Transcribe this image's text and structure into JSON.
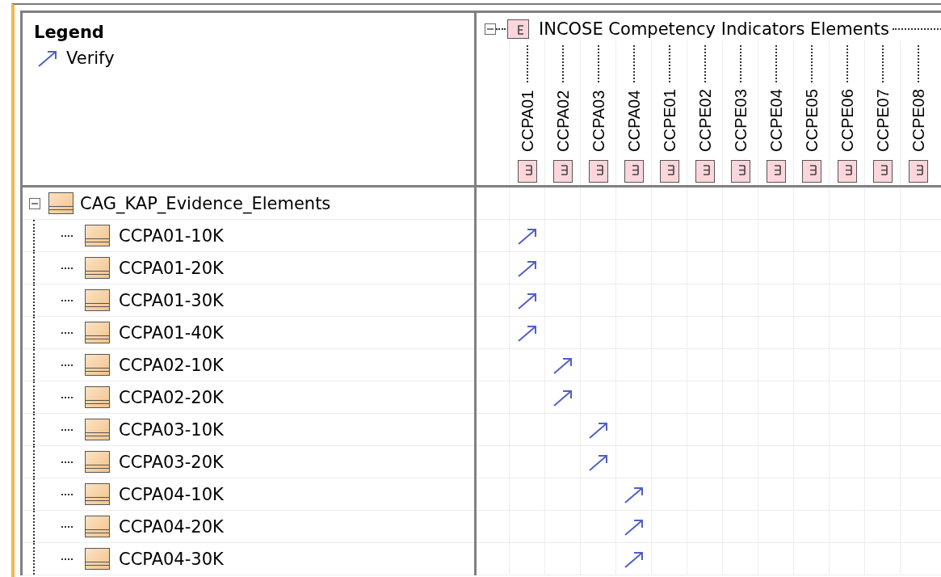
{
  "legend": {
    "title": "Legend",
    "items": [
      {
        "kind": "verify",
        "label": "Verify"
      }
    ]
  },
  "column_group": {
    "label": "INCOSE Competency Indicators Elements",
    "expanded": true,
    "columns": [
      "CCPA01",
      "CCPA02",
      "CCPA03",
      "CCPA04",
      "CCPE01",
      "CCPE02",
      "CCPE03",
      "CCPE04",
      "CCPE05",
      "CCPE06",
      "CCPE07",
      "CCPE08"
    ]
  },
  "row_group": {
    "label": "CAG_KAP_Evidence_Elements",
    "expanded": true,
    "cells": [
      false,
      false,
      false,
      false,
      false,
      false,
      false,
      false,
      false,
      false,
      false,
      false
    ],
    "children": [
      {
        "label": "CCPA01-10K",
        "cells": [
          true,
          false,
          false,
          false,
          false,
          false,
          false,
          false,
          false,
          false,
          false,
          false
        ]
      },
      {
        "label": "CCPA01-20K",
        "cells": [
          true,
          false,
          false,
          false,
          false,
          false,
          false,
          false,
          false,
          false,
          false,
          false
        ]
      },
      {
        "label": "CCPA01-30K",
        "cells": [
          true,
          false,
          false,
          false,
          false,
          false,
          false,
          false,
          false,
          false,
          false,
          false
        ]
      },
      {
        "label": "CCPA01-40K",
        "cells": [
          true,
          false,
          false,
          false,
          false,
          false,
          false,
          false,
          false,
          false,
          false,
          false
        ]
      },
      {
        "label": "CCPA02-10K",
        "cells": [
          false,
          true,
          false,
          false,
          false,
          false,
          false,
          false,
          false,
          false,
          false,
          false
        ]
      },
      {
        "label": "CCPA02-20K",
        "cells": [
          false,
          true,
          false,
          false,
          false,
          false,
          false,
          false,
          false,
          false,
          false,
          false
        ]
      },
      {
        "label": "CCPA03-10K",
        "cells": [
          false,
          false,
          true,
          false,
          false,
          false,
          false,
          false,
          false,
          false,
          false,
          false
        ]
      },
      {
        "label": "CCPA03-20K",
        "cells": [
          false,
          false,
          true,
          false,
          false,
          false,
          false,
          false,
          false,
          false,
          false,
          false
        ]
      },
      {
        "label": "CCPA04-10K",
        "cells": [
          false,
          false,
          false,
          true,
          false,
          false,
          false,
          false,
          false,
          false,
          false,
          false
        ]
      },
      {
        "label": "CCPA04-20K",
        "cells": [
          false,
          false,
          false,
          true,
          false,
          false,
          false,
          false,
          false,
          false,
          false,
          false
        ]
      },
      {
        "label": "CCPA04-30K",
        "cells": [
          false,
          false,
          false,
          true,
          false,
          false,
          false,
          false,
          false,
          false,
          false,
          false
        ]
      }
    ]
  }
}
